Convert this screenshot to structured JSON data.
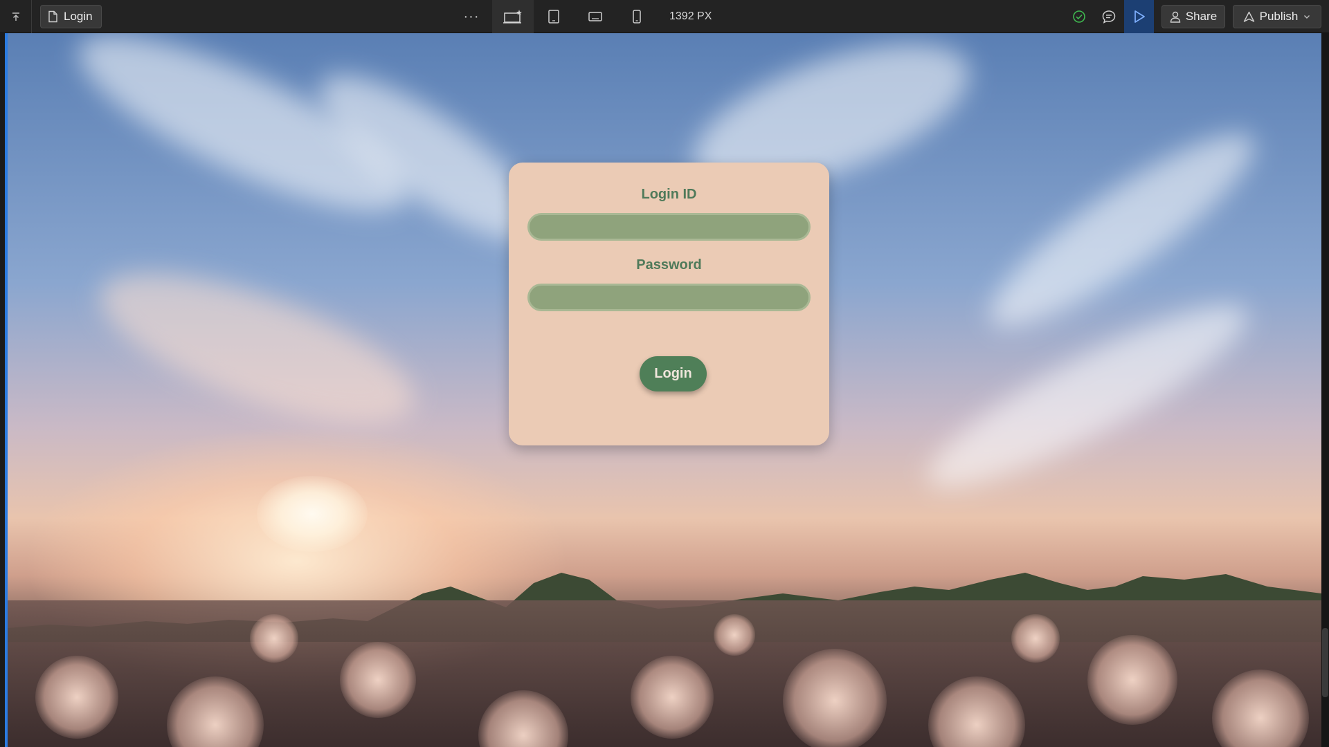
{
  "toolbar": {
    "page_name": "Login",
    "more_label": "···",
    "width_readout": "1392 PX",
    "share_label": "Share",
    "publish_label": "Publish",
    "active_device": "desktop",
    "icons": {
      "collapse": "collapse-up-icon",
      "page": "page-icon",
      "desktop": "desktop-breakpoint-icon",
      "tablet": "tablet-icon",
      "landscape": "tablet-landscape-icon",
      "mobile": "mobile-icon",
      "status": "check-circle-icon",
      "comments": "comments-icon",
      "preview": "play-icon",
      "share": "user-icon",
      "publish": "publish-icon",
      "dropdown": "chevron-down-icon"
    },
    "colors": {
      "bar": "#232323",
      "play_active": "#1c3f73",
      "status_ok": "#3fb950"
    }
  },
  "login_form": {
    "login_id_label": "Login ID",
    "login_id_value": "",
    "password_label": "Password",
    "password_value": "",
    "submit_label": "Login",
    "colors": {
      "card": "#ebcbb5",
      "label": "#4f7a5a",
      "input": "#8fa37c",
      "button": "#4f7f58"
    }
  }
}
